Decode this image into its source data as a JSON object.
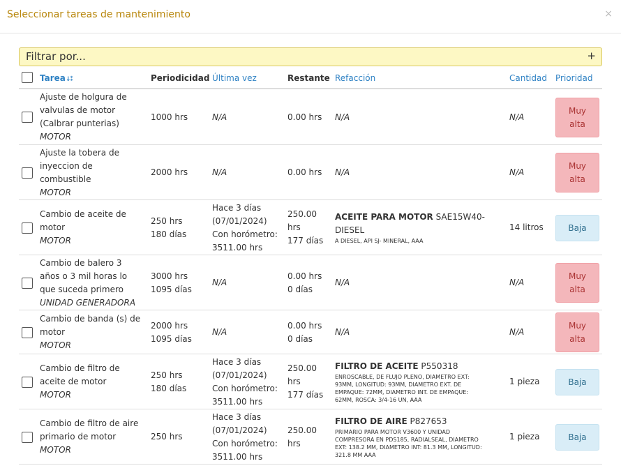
{
  "dialog": {
    "title": "Seleccionar tareas de mantenimiento",
    "close_glyph": "×"
  },
  "filter": {
    "label": "Filtrar por...",
    "add_glyph": "+"
  },
  "columns": {
    "tarea": "Tarea",
    "sort_glyph": "↓⁑",
    "periodicidad": "Periodicidad",
    "ultima_vez": "Última vez",
    "restante": "Restante",
    "refaccion": "Refacción",
    "cantidad": "Cantidad",
    "prioridad": "Prioridad"
  },
  "rows": [
    {
      "task": [
        "Ajuste de holgura de",
        "valvulas de motor",
        "(Calbrar punterias)"
      ],
      "category": "MOTOR",
      "period": [
        "1000 hrs"
      ],
      "last": [
        "N/A"
      ],
      "remaining": [
        "0.00 hrs"
      ],
      "part_name": "",
      "part_text": [
        "N/A"
      ],
      "part_desc": [],
      "qty": "N/A",
      "priority": [
        "Muy",
        "alta"
      ]
    },
    {
      "task": [
        "Ajuste la tobera de",
        "inyeccion de",
        "combustible"
      ],
      "category": "MOTOR",
      "period": [
        "2000 hrs"
      ],
      "last": [
        "N/A"
      ],
      "remaining": [
        "0.00 hrs"
      ],
      "part_name": "",
      "part_text": [
        "N/A"
      ],
      "part_desc": [],
      "qty": "N/A",
      "priority": [
        "Muy",
        "alta"
      ]
    },
    {
      "task": [
        "Cambio de aceite de",
        "motor"
      ],
      "category": "MOTOR",
      "period": [
        "250 hrs",
        "180 días"
      ],
      "last": [
        "Hace 3 días",
        "(07/01/2024)",
        "Con horómetro:",
        "3511.00 hrs"
      ],
      "remaining": [
        "250.00",
        "hrs",
        "177 días"
      ],
      "part_name": "ACEITE PARA MOTOR",
      "part_text": [
        " SAE15W40-",
        "DIESEL"
      ],
      "part_desc": [
        "A DIESEL, API SJ- MINERAL, AAA"
      ],
      "qty": "14 litros",
      "priority": [
        "Baja"
      ]
    },
    {
      "task": [
        "Cambio de balero 3",
        "años o 3 mil horas lo",
        "que suceda primero"
      ],
      "category": "UNIDAD GENERADORA",
      "period": [
        "3000 hrs",
        "1095 días"
      ],
      "last": [
        "N/A"
      ],
      "remaining": [
        "0.00 hrs",
        "0 días"
      ],
      "part_name": "",
      "part_text": [
        "N/A"
      ],
      "part_desc": [],
      "qty": "N/A",
      "priority": [
        "Muy",
        "alta"
      ]
    },
    {
      "task": [
        "Cambio de banda (s) de",
        "motor"
      ],
      "category": "MOTOR",
      "period": [
        "2000 hrs",
        "1095 días"
      ],
      "last": [
        "N/A"
      ],
      "remaining": [
        "0.00 hrs",
        "0 días"
      ],
      "part_name": "",
      "part_text": [
        "N/A"
      ],
      "part_desc": [],
      "qty": "N/A",
      "priority": [
        "Muy",
        "alta"
      ]
    },
    {
      "task": [
        "Cambio de filtro de",
        "aceite de motor"
      ],
      "category": "MOTOR",
      "period": [
        "250 hrs",
        "180 días"
      ],
      "last": [
        "Hace 3 días",
        "(07/01/2024)",
        "Con horómetro:",
        "3511.00 hrs"
      ],
      "remaining": [
        "250.00",
        "hrs",
        "177 días"
      ],
      "part_name": "FILTRO DE ACEITE",
      "part_text": [
        " P550318"
      ],
      "part_desc": [
        "ENROSCABLE, DE FLUJO PLENO, DIAMETRO EXT:",
        "93MM, LONGITUD: 93MM, DIAMETRO EXT. DE",
        "EMPAQUE: 72MM, DIAMETRO INT. DE EMPAQUE:",
        "62MM, ROSCA: 3/4-16 UN, AAA"
      ],
      "qty": "1 pieza",
      "priority": [
        "Baja"
      ]
    },
    {
      "task": [
        "Cambio de filtro de aire",
        "primario de motor"
      ],
      "category": "MOTOR",
      "period": [
        "250 hrs"
      ],
      "last": [
        "Hace 3 días",
        "(07/01/2024)",
        "Con horómetro:",
        "3511.00 hrs"
      ],
      "remaining": [
        "250.00",
        "hrs"
      ],
      "part_name": "FILTRO DE AIRE",
      "part_text": [
        " P827653"
      ],
      "part_desc": [
        "PRIMARIO PARA MOTOR V3600 Y UNIDAD",
        "COMPRESORA EN PDS185, RADIALSEAL, DIAMETRO",
        "EXT: 138.2 MM, DIAMETRO INT: 81.3 MM, LONGITUD:",
        "321.8 MM AAA"
      ],
      "qty": "1 pieza",
      "priority": [
        "Baja"
      ]
    }
  ],
  "colors": {
    "title": "#b8860b",
    "link": "#2f82c4",
    "high_bg": "#f4b7bb",
    "low_bg": "#d9edf7"
  }
}
